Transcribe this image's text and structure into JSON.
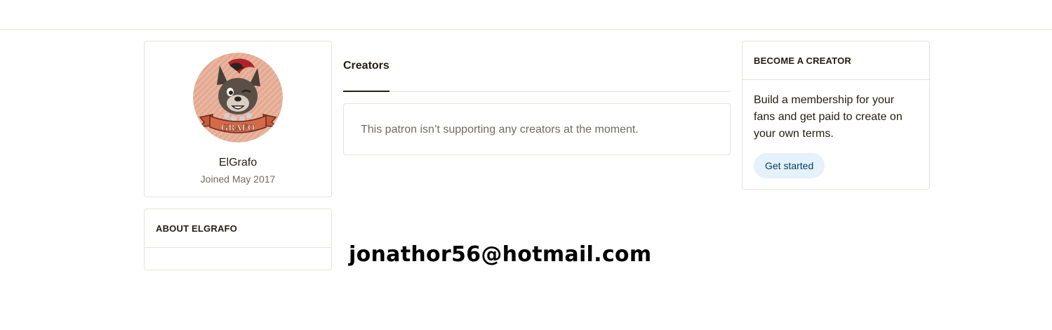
{
  "profile": {
    "name": "ElGrafo",
    "joined": "Joined May 2017",
    "avatar_icon": "wolf-avatar-icon",
    "avatar_banner_text": "GRAFO"
  },
  "about": {
    "header": "ABOUT ELGRAFO"
  },
  "creators": {
    "tab_label": "Creators",
    "empty_message": "This patron isn’t supporting any creators at the moment."
  },
  "become_creator": {
    "header": "BECOME A CREATOR",
    "body": "Build a membership for your fans and get paid to create on your own terms.",
    "button_label": "Get started"
  },
  "overlay": {
    "email": "jonathor56@hotmail.com"
  },
  "colors": {
    "border": "#e5e3dd",
    "text": "#241e12",
    "muted": "#706c64",
    "button_bg": "#e5f1fb",
    "button_text": "#0a3c66"
  }
}
